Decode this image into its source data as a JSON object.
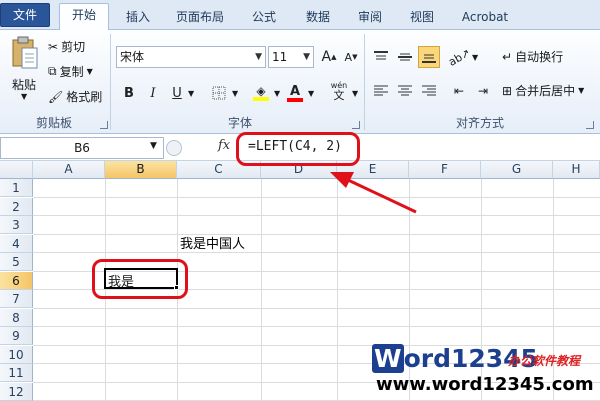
{
  "tabs": {
    "file": "文件",
    "home": "开始",
    "insert": "插入",
    "page_layout": "页面布局",
    "formulas": "公式",
    "data": "数据",
    "review": "审阅",
    "view": "视图",
    "acrobat": "Acrobat"
  },
  "clipboard": {
    "paste": "粘贴",
    "cut": "剪切",
    "copy": "复制",
    "format_painter": "格式刷",
    "group_label": "剪贴板"
  },
  "font": {
    "name": "宋体",
    "size": "11",
    "bold": "B",
    "italic": "I",
    "underline": "U",
    "group_label": "字体",
    "grow": "A",
    "shrink": "A",
    "phonetic": "wén"
  },
  "alignment": {
    "wrap_text": "自动换行",
    "merge_center": "合并后居中",
    "group_label": "对齐方式"
  },
  "formula_bar": {
    "name_box": "B6",
    "fx": "fx",
    "formula": "=LEFT(C4, 2)"
  },
  "grid": {
    "columns": [
      "A",
      "B",
      "C",
      "D",
      "E",
      "F",
      "G",
      "H"
    ],
    "rows": [
      "1",
      "2",
      "3",
      "4",
      "5",
      "6",
      "7",
      "8",
      "9",
      "10",
      "11",
      "12"
    ],
    "active_column": "B",
    "active_row": "6",
    "c4_value": "我是中国人",
    "b6_value": "我是"
  },
  "watermark": {
    "brand_w": "W",
    "brand_rest": "ord12345",
    "tagline": "办公软件教程",
    "url": "www.word12345.com"
  },
  "colors": {
    "accent_red": "#e0101a",
    "file_tab": "#2a5699",
    "active_header": "#f4c566"
  }
}
